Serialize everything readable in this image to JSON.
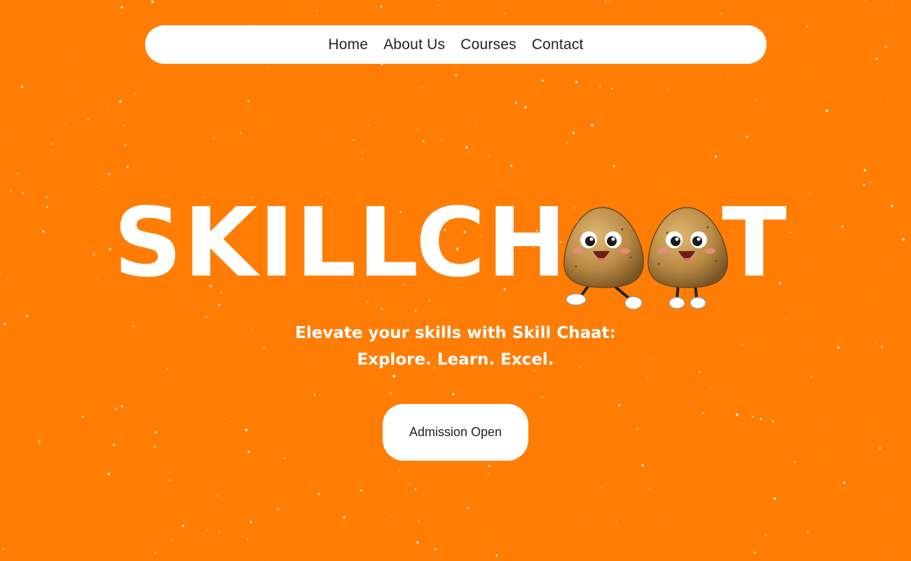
{
  "nav": {
    "items": [
      {
        "label": "Home"
      },
      {
        "label": "About Us"
      },
      {
        "label": "Courses"
      },
      {
        "label": "Contact"
      }
    ]
  },
  "hero": {
    "title_part1": "SKILL",
    "title_part2": "CH",
    "title_part3": "T",
    "mascot_icon": "potato-mascot-icon",
    "tagline_line1": "Elevate your skills with Skill Chaat:",
    "tagline_line2": "Explore. Learn. Excel.",
    "cta_label": "Admission Open"
  },
  "colors": {
    "background": "#ff7d05",
    "text": "#ffffff",
    "nav_bg": "#ffffff",
    "nav_text": "#222222"
  }
}
